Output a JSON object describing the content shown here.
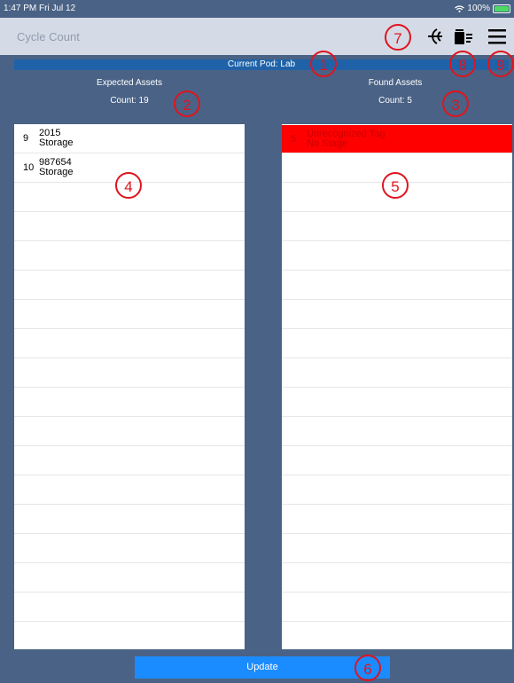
{
  "status_bar": {
    "time": "1:47 PM  Fri Jul 12",
    "battery": "100%",
    "battery_level": 1.0
  },
  "nav": {
    "title": "Cycle Count",
    "icons": [
      "nfc-signal-icon",
      "trash-list-icon",
      "menu-icon"
    ]
  },
  "pod": {
    "label": "Current Pod: Lab"
  },
  "expected": {
    "heading": "Expected Assets",
    "count": "Count: 19",
    "rows": [
      {
        "num": "9",
        "line1": "2015",
        "line2": "Storage"
      },
      {
        "num": "10",
        "line1": "987654",
        "line2": "Storage"
      }
    ]
  },
  "found": {
    "heading": "Found Assets",
    "count": "Count: 5",
    "rows": [
      {
        "num": "5",
        "line1": "Unrecognized Tag",
        "line2": "No Stage"
      }
    ]
  },
  "update_button": {
    "label": "Update"
  },
  "annotations": [
    "1",
    "2",
    "3",
    "4",
    "5",
    "6",
    "7",
    "8",
    "9"
  ],
  "colors": {
    "background": "#4a6285",
    "navbar": "#d5dbe6",
    "pod_bar": "#1f62a8",
    "button": "#1a8cff",
    "alert_row": "#ff0000",
    "annotation": "#e0141e"
  }
}
